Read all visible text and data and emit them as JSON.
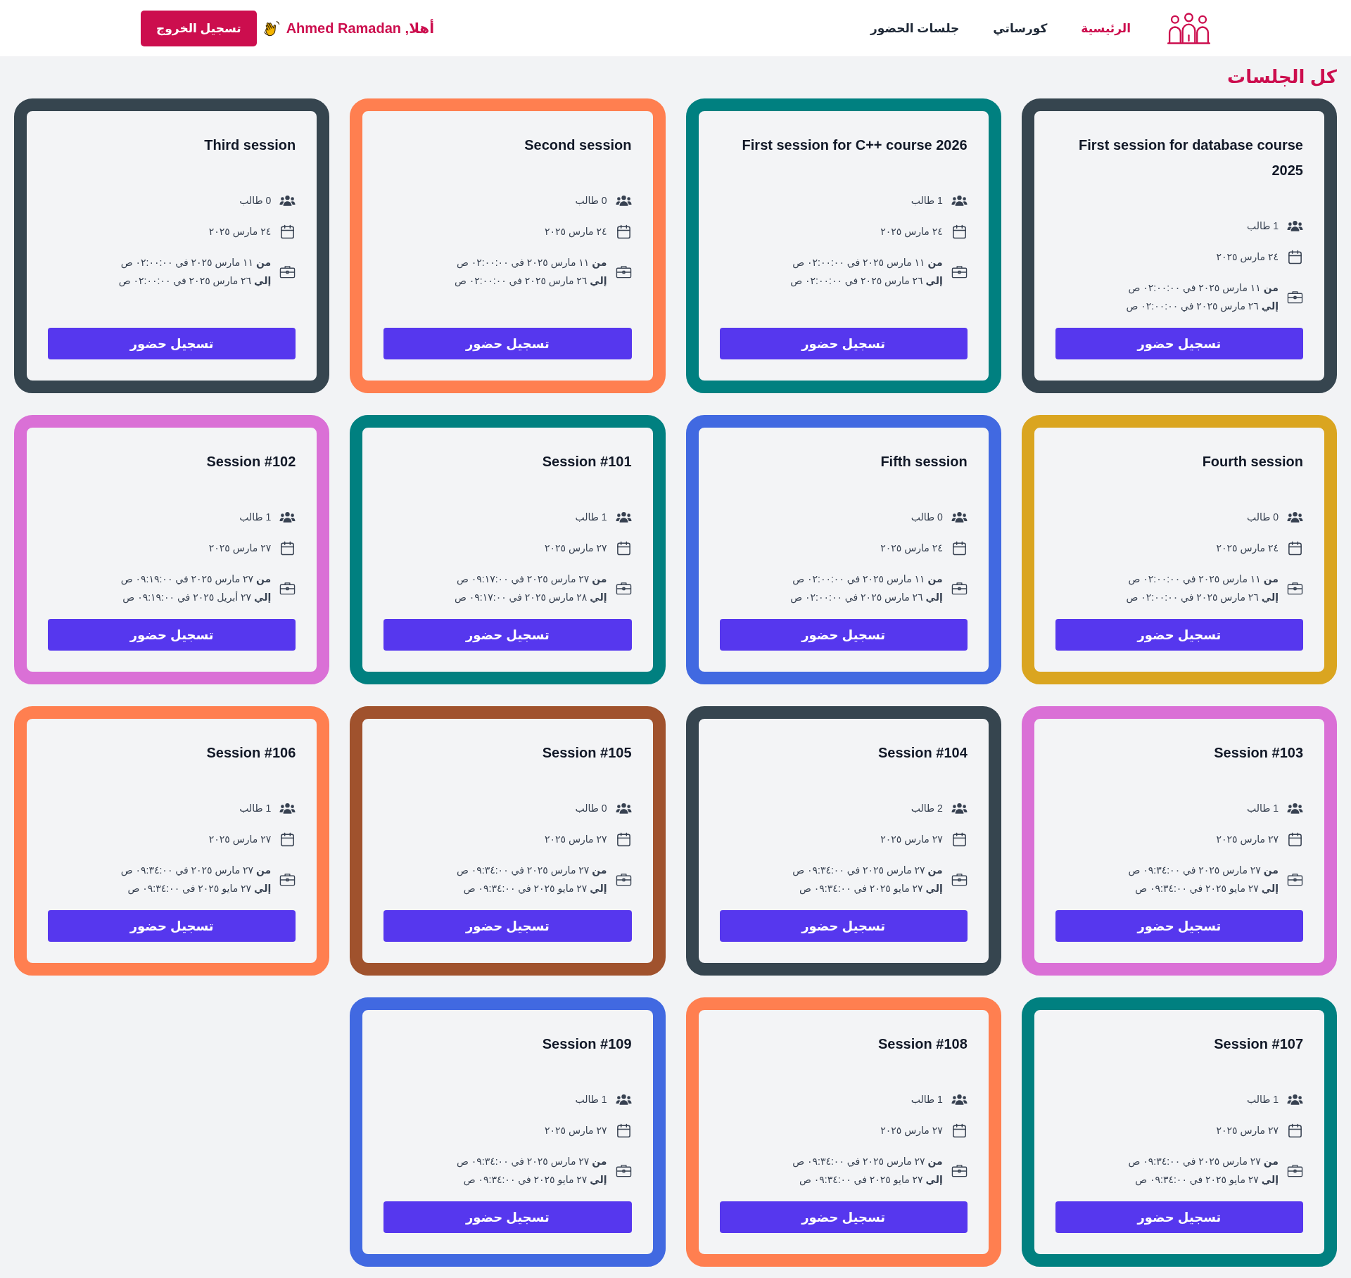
{
  "header": {
    "nav": [
      {
        "label": "الرئيسية",
        "selected": true
      },
      {
        "label": "كورساتي",
        "selected": false
      },
      {
        "label": "جلسات الحضور",
        "selected": false
      }
    ],
    "greeting": "أهلا, Ahmed Ramadan",
    "logout": "تسجيل الخروج"
  },
  "page_title": "كل الجلسات",
  "sessions": [
    {
      "title": "First session for database course 2025",
      "color": "#36454f",
      "students": "1 طالب",
      "date": "٢٤ مارس ٢٠٢٥",
      "from": "**من** ١١ مارس ٢٠٢٥ في ٠٢:٠٠:٠٠ ص",
      "to": "**إلي** ٢٦ مارس ٢٠٢٥ في ٠٢:٠٠:٠٠ ص",
      "button": "تسجيل حضور"
    },
    {
      "title": "First session for C++ course 2026",
      "color": "#008080",
      "students": "1 طالب",
      "date": "٢٤ مارس ٢٠٢٥",
      "from": "**من** ١١ مارس ٢٠٢٥ في ٠٢:٠٠:٠٠ ص",
      "to": "**إلي** ٢٦ مارس ٢٠٢٥ في ٠٢:٠٠:٠٠ ص",
      "button": "تسجيل حضور"
    },
    {
      "title": "Second session",
      "color": "#ff7f50",
      "students": "0 طالب",
      "date": "٢٤ مارس ٢٠٢٥",
      "from": "**من** ١١ مارس ٢٠٢٥ في ٠٢:٠٠:٠٠ ص",
      "to": "**إلي** ٢٦ مارس ٢٠٢٥ في ٠٢:٠٠:٠٠ ص",
      "button": "تسجيل حضور"
    },
    {
      "title": "Third session",
      "color": "#36454f",
      "students": "0 طالب",
      "date": "٢٤ مارس ٢٠٢٥",
      "from": "**من** ١١ مارس ٢٠٢٥ في ٠٢:٠٠:٠٠ ص",
      "to": "**إلي** ٢٦ مارس ٢٠٢٥ في ٠٢:٠٠:٠٠ ص",
      "button": "تسجيل حضور"
    },
    {
      "title": "Fourth session",
      "color": "#daa520",
      "students": "0 طالب",
      "date": "٢٤ مارس ٢٠٢٥",
      "from": "**من** ١١ مارس ٢٠٢٥ في ٠٢:٠٠:٠٠ ص",
      "to": "**إلي** ٢٦ مارس ٢٠٢٥ في ٠٢:٠٠:٠٠ ص",
      "button": "تسجيل حضور"
    },
    {
      "title": "Fifth session",
      "color": "#4169e1",
      "students": "0 طالب",
      "date": "٢٤ مارس ٢٠٢٥",
      "from": "**من** ١١ مارس ٢٠٢٥ في ٠٢:٠٠:٠٠ ص",
      "to": "**إلي** ٢٦ مارس ٢٠٢٥ في ٠٢:٠٠:٠٠ ص",
      "button": "تسجيل حضور"
    },
    {
      "title": "Session #101",
      "color": "#008080",
      "students": "1 طالب",
      "date": "٢٧ مارس ٢٠٢٥",
      "from": "**من** ٢٧ مارس ٢٠٢٥ في ٠٩:١٧:٠٠ ص",
      "to": "**إلي** ٢٨ مارس ٢٠٢٥ في ٠٩:١٧:٠٠ ص",
      "button": "تسجيل حضور"
    },
    {
      "title": "Session #102",
      "color": "#da70d6",
      "students": "1 طالب",
      "date": "٢٧ مارس ٢٠٢٥",
      "from": "**من** ٢٧ مارس ٢٠٢٥ في ٠٩:١٩:٠٠ ص",
      "to": "**إلي** ٢٧ أبريل ٢٠٢٥ في ٠٩:١٩:٠٠ ص",
      "button": "تسجيل حضور"
    },
    {
      "title": "Session #103",
      "color": "#da70d6",
      "students": "1 طالب",
      "date": "٢٧ مارس ٢٠٢٥",
      "from": "**من** ٢٧ مارس ٢٠٢٥ في ٠٩:٣٤:٠٠ ص",
      "to": "**إلي** ٢٧ مايو ٢٠٢٥ في ٠٩:٣٤:٠٠ ص",
      "button": "تسجيل حضور"
    },
    {
      "title": "Session #104",
      "color": "#36454f",
      "students": "2 طالب",
      "date": "٢٧ مارس ٢٠٢٥",
      "from": "**من** ٢٧ مارس ٢٠٢٥ في ٠٩:٣٤:٠٠ ص",
      "to": "**إلي** ٢٧ مايو ٢٠٢٥ في ٠٩:٣٤:٠٠ ص",
      "button": "تسجيل حضور"
    },
    {
      "title": "Session #105",
      "color": "#a0522d",
      "students": "0 طالب",
      "date": "٢٧ مارس ٢٠٢٥",
      "from": "**من** ٢٧ مارس ٢٠٢٥ في ٠٩:٣٤:٠٠ ص",
      "to": "**إلي** ٢٧ مايو ٢٠٢٥ في ٠٩:٣٤:٠٠ ص",
      "button": "تسجيل حضور"
    },
    {
      "title": "Session #106",
      "color": "#ff7f50",
      "students": "1 طالب",
      "date": "٢٧ مارس ٢٠٢٥",
      "from": "**من** ٢٧ مارس ٢٠٢٥ في ٠٩:٣٤:٠٠ ص",
      "to": "**إلي** ٢٧ مايو ٢٠٢٥ في ٠٩:٣٤:٠٠ ص",
      "button": "تسجيل حضور"
    },
    {
      "title": "Session #107",
      "color": "#008080",
      "students": "1 طالب",
      "date": "٢٧ مارس ٢٠٢٥",
      "from": "**من** ٢٧ مارس ٢٠٢٥ في ٠٩:٣٤:٠٠ ص",
      "to": "**إلي** ٢٧ مايو ٢٠٢٥ في ٠٩:٣٤:٠٠ ص",
      "button": "تسجيل حضور"
    },
    {
      "title": "Session #108",
      "color": "#ff7f50",
      "students": "1 طالب",
      "date": "٢٧ مارس ٢٠٢٥",
      "from": "**من** ٢٧ مارس ٢٠٢٥ في ٠٩:٣٤:٠٠ ص",
      "to": "**إلي** ٢٧ مايو ٢٠٢٥ في ٠٩:٣٤:٠٠ ص",
      "button": "تسجيل حضور"
    },
    {
      "title": "Session #109",
      "color": "#4169e1",
      "students": "1 طالب",
      "date": "٢٧ مارس ٢٠٢٥",
      "from": "**من** ٢٧ مارس ٢٠٢٥ في ٠٩:٣٤:٠٠ ص",
      "to": "**إلي** ٢٧ مايو ٢٠٢٥ في ٠٩:٣٤:٠٠ ص",
      "button": "تسجيل حضور"
    }
  ]
}
